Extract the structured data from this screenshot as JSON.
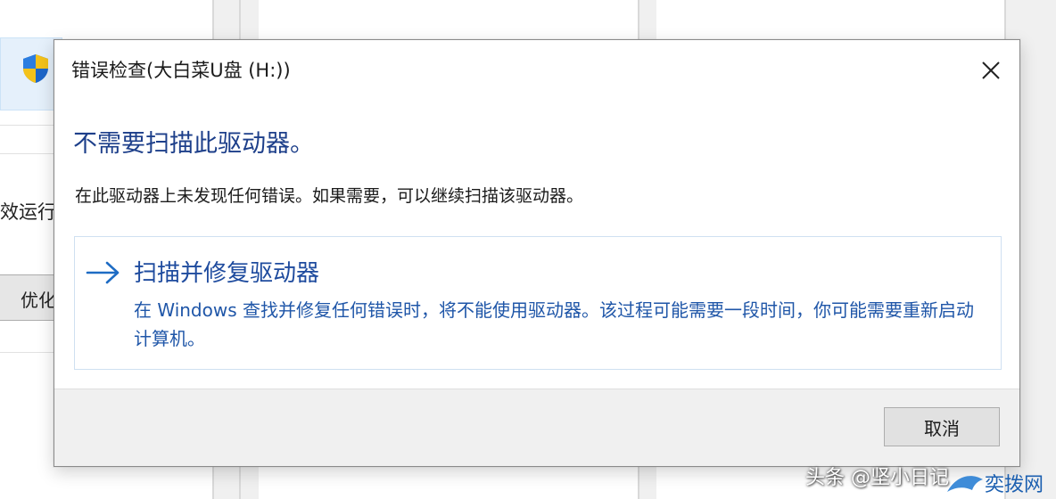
{
  "background_window": {
    "partial_label": "效运行",
    "partial_button_label": "优化",
    "shield_icon": "uac-shield-icon"
  },
  "dialog": {
    "title": "错误检查(大白菜U盘 (H:))",
    "heading": "不需要扫描此驱动器。",
    "message": "在此驱动器上未发现任何错误。如果需要，可以继续扫描该驱动器。",
    "command_link": {
      "icon": "arrow-right-icon",
      "title": "扫描并修复驱动器",
      "description": "在 Windows 查找并修复任何错误时，将不能使用驱动器。该过程可能需要一段时间，你可能需要重新启动计算机。"
    },
    "cancel_label": "取消",
    "close_icon": "close-icon"
  },
  "watermark": {
    "text": "头条 @坚小日记",
    "logo_text": "奕拨网"
  },
  "colors": {
    "heading": "#1d3f8a",
    "link_title": "#1e4b9e",
    "link_desc": "#1f56a8",
    "footer": "#f0f0f0"
  }
}
